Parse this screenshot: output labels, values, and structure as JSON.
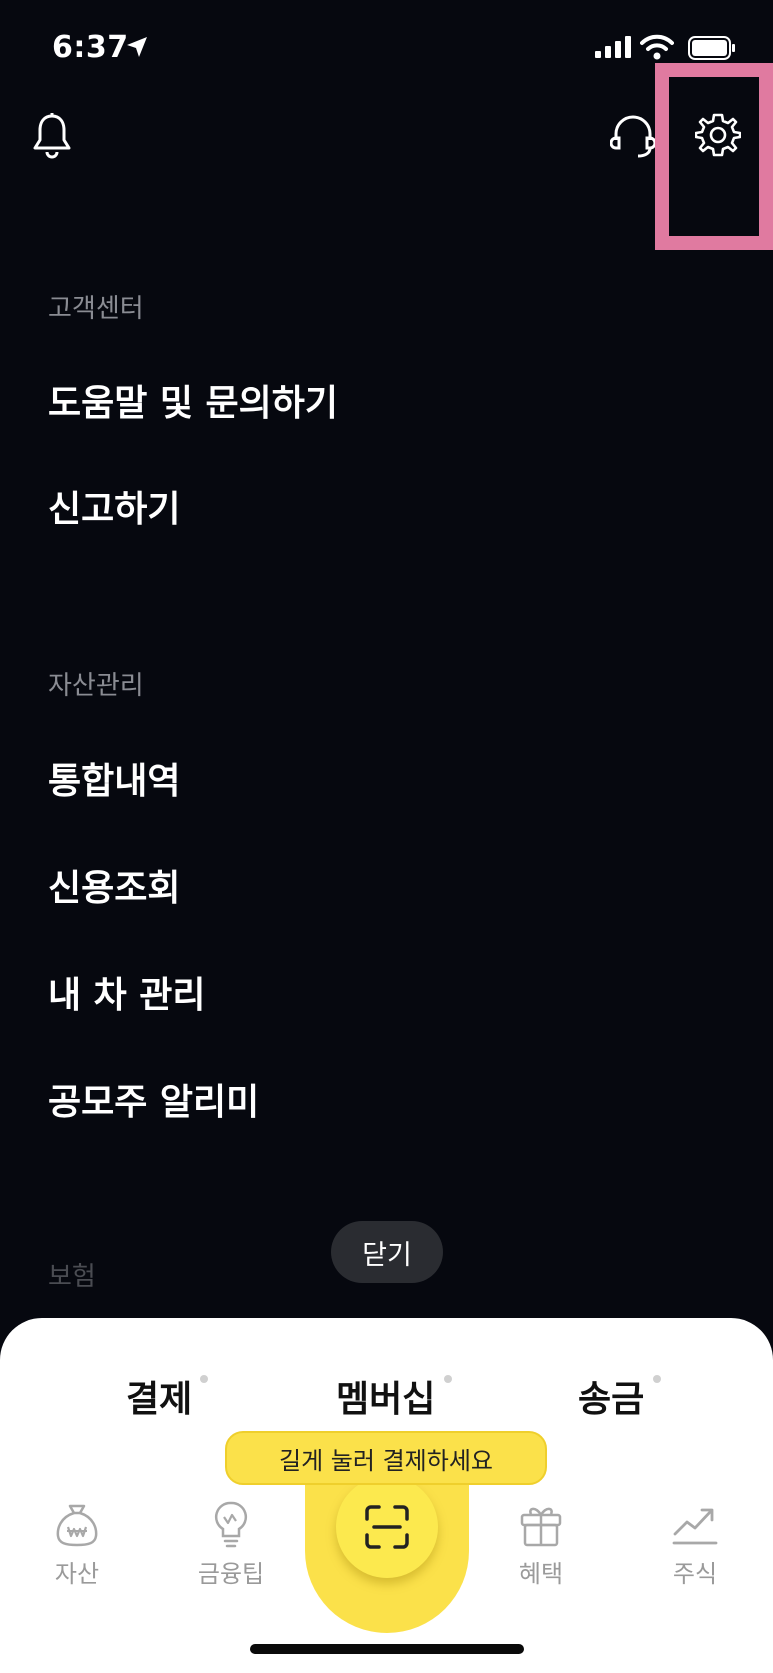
{
  "status_bar": {
    "time": "6:37"
  },
  "sections": [
    {
      "title": "고객센터",
      "items": [
        "도움말 및 문의하기",
        "신고하기"
      ]
    },
    {
      "title": "자산관리",
      "items": [
        "통합내역",
        "신용조회",
        "내 차 관리",
        "공모주 알리미"
      ]
    },
    {
      "title": "보험",
      "items": []
    }
  ],
  "close_label": "닫기",
  "payment_tabs": [
    "결제",
    "멤버십",
    "송금"
  ],
  "tooltip": "길게 눌러 결제하세요",
  "bottom_nav": [
    {
      "label": "자산",
      "icon": "money-bag-icon"
    },
    {
      "label": "금융팁",
      "icon": "lightbulb-icon"
    },
    {
      "label": "혜택",
      "icon": "gift-icon"
    },
    {
      "label": "주식",
      "icon": "stock-chart-icon"
    }
  ],
  "colors": {
    "accent": "#fbe14a",
    "highlight": "#e07aa0",
    "background": "#06080f"
  }
}
